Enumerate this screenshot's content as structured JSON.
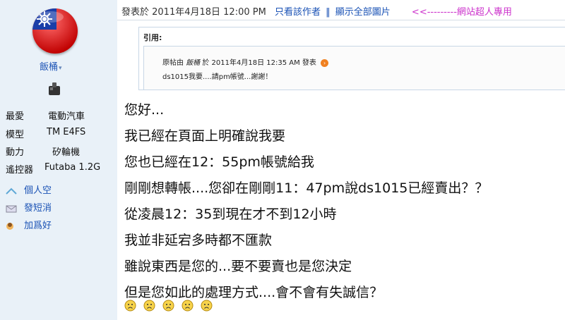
{
  "user": {
    "name": "飯桶",
    "info": [
      {
        "label": "最愛",
        "value": "電動汽車"
      },
      {
        "label": "模型",
        "value": "TM E4FS"
      },
      {
        "label": "動力",
        "value": "矽輪機"
      },
      {
        "label": "遙控器",
        "value": "Futaba 1.2G"
      }
    ],
    "actions": [
      {
        "label": "個人空",
        "icon": "profile-icon"
      },
      {
        "label": "發短消",
        "icon": "message-icon"
      },
      {
        "label": "加爲好",
        "icon": "add-friend-icon"
      }
    ]
  },
  "post": {
    "posted_at": "發表於 2011年4月18日 12:00 PM",
    "only_author": "只看該作者",
    "separator": "‖",
    "show_images": "顯示全部圖片",
    "note": "<<---------網站超人專用"
  },
  "quote": {
    "label": "引用:",
    "meta_prefix": "原帖由",
    "meta_author": "飯桶",
    "meta_suffix": "於 2011年4月18日 12:35 AM 發表",
    "body": "ds1015我要....請pm帳號...謝謝！"
  },
  "message_lines": [
    "您好...",
    "我已經在頁面上明確說我要",
    "您也已經在12：55pm帳號給我",
    "剛剛想轉帳....您卻在剛剛11：47pm說ds1015已經賣出？？",
    "從凌晨12：35到現在才不到12小時",
    "我並非延宕多時都不匯款",
    "雖說東西是您的...要不要賣也是您決定",
    "但是您如此的處理方式....會不會有失誠信？"
  ],
  "emoji_count": 5,
  "colors": {
    "sidebar": "#e9f1f8",
    "link": "#1a52b5",
    "note": "#cc33cc"
  }
}
